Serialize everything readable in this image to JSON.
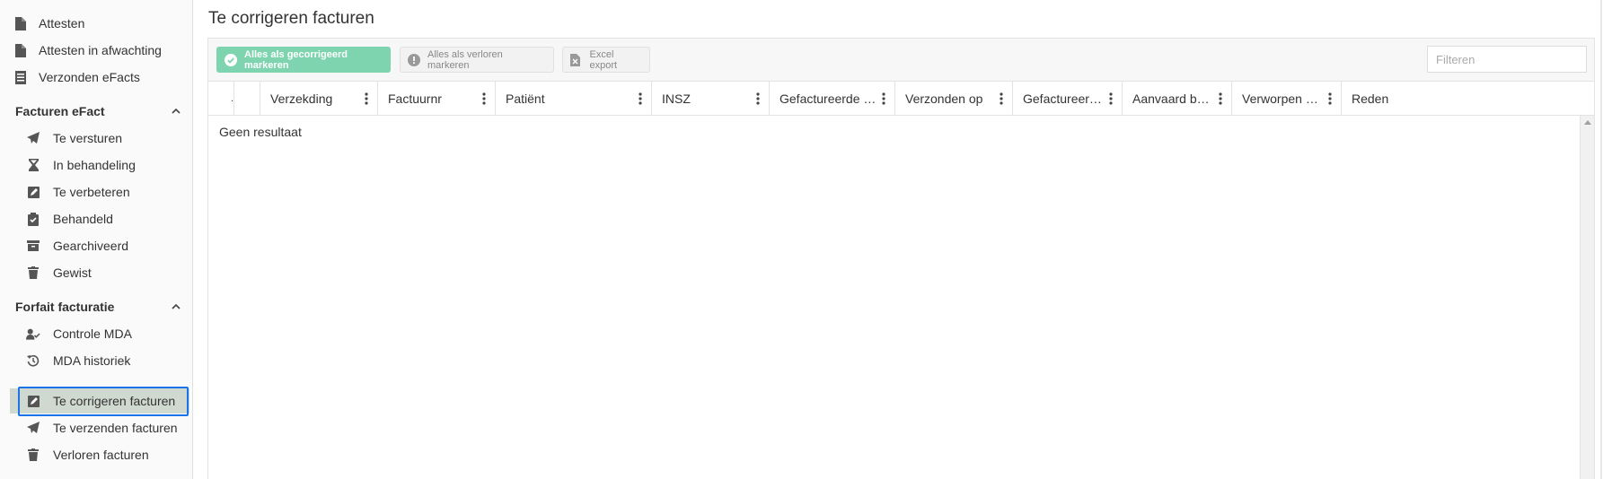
{
  "sidebar": {
    "top_items": [
      {
        "label": "Attesten",
        "icon": "file-icon"
      },
      {
        "label": "Attesten in afwachting",
        "icon": "file-icon"
      },
      {
        "label": "Verzonden eFacts",
        "icon": "list-file-icon"
      }
    ],
    "sections": [
      {
        "title": "Facturen eFact",
        "items": [
          {
            "label": "Te versturen",
            "icon": "paper-plane-icon"
          },
          {
            "label": "In behandeling",
            "icon": "hourglass-icon"
          },
          {
            "label": "Te verbeteren",
            "icon": "edit-icon"
          },
          {
            "label": "Behandeld",
            "icon": "clipboard-check-icon"
          },
          {
            "label": "Gearchiveerd",
            "icon": "archive-icon"
          },
          {
            "label": "Gewist",
            "icon": "trash-icon"
          }
        ]
      },
      {
        "title": "Forfait facturatie",
        "items": [
          {
            "label": "Controle MDA",
            "icon": "user-check-icon"
          },
          {
            "label": "MDA historiek",
            "icon": "history-icon"
          }
        ]
      }
    ],
    "bottom_items": [
      {
        "label": "Te corrigeren facturen",
        "icon": "edit-icon",
        "active": true
      },
      {
        "label": "Te verzenden facturen",
        "icon": "paper-plane-icon"
      },
      {
        "label": "Verloren facturen",
        "icon": "trash-icon"
      }
    ]
  },
  "main": {
    "title": "Te corrigeren facturen",
    "toolbar": {
      "mark_corrected_label": "Alles als gecorrigeerd markeren",
      "mark_lost_label": "Alles als verloren markeren",
      "excel_label": "Excel export",
      "filter_placeholder": "Filteren"
    },
    "columns": [
      "",
      "",
      "Verzekding",
      "Factuurnr",
      "Patiënt",
      "INSZ",
      "Gefactureerde …",
      "Verzonden op",
      "Gefactureer…",
      "Aanvaard b…",
      "Verworpen …",
      "Reden"
    ],
    "empty_text": "Geen resultaat"
  },
  "colors": {
    "accent_green": "#7dd4ae",
    "active_bg": "#d0d9d0",
    "focus_border": "#1a73e8"
  }
}
